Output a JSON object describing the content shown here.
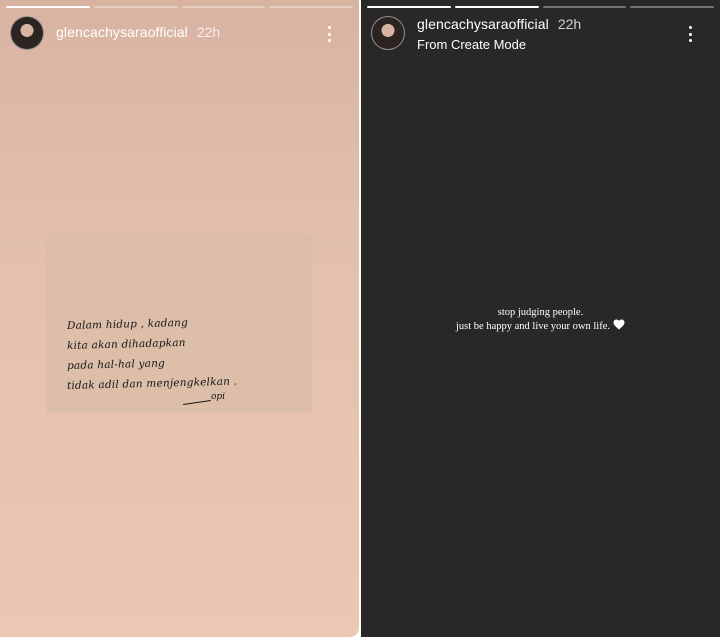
{
  "stories": [
    {
      "username": "glencachysaraofficial",
      "time": "22h",
      "progress": [
        1,
        0,
        0,
        0
      ],
      "note": {
        "lines": [
          "Dalam hidup , kadang",
          "kita akan dihadapkan",
          "pada hal-hal yang",
          "tidak adil dan menjengkelkan ."
        ],
        "signature": "opi"
      }
    },
    {
      "username": "glencachysaraofficial",
      "time": "22h",
      "subtitle": "From Create Mode",
      "progress": [
        1,
        1,
        0,
        0
      ],
      "caption": {
        "line1": "stop judging people.",
        "line2": "just be happy and live your own life."
      },
      "heart_icon": "white-heart-icon"
    }
  ],
  "colors": {
    "left_background": "#e3c0ae",
    "right_background": "#282828",
    "note_paper": "#ddbfa9",
    "text_white": "#ffffff"
  },
  "icons": [
    "more-options-icon",
    "white-heart-icon"
  ]
}
